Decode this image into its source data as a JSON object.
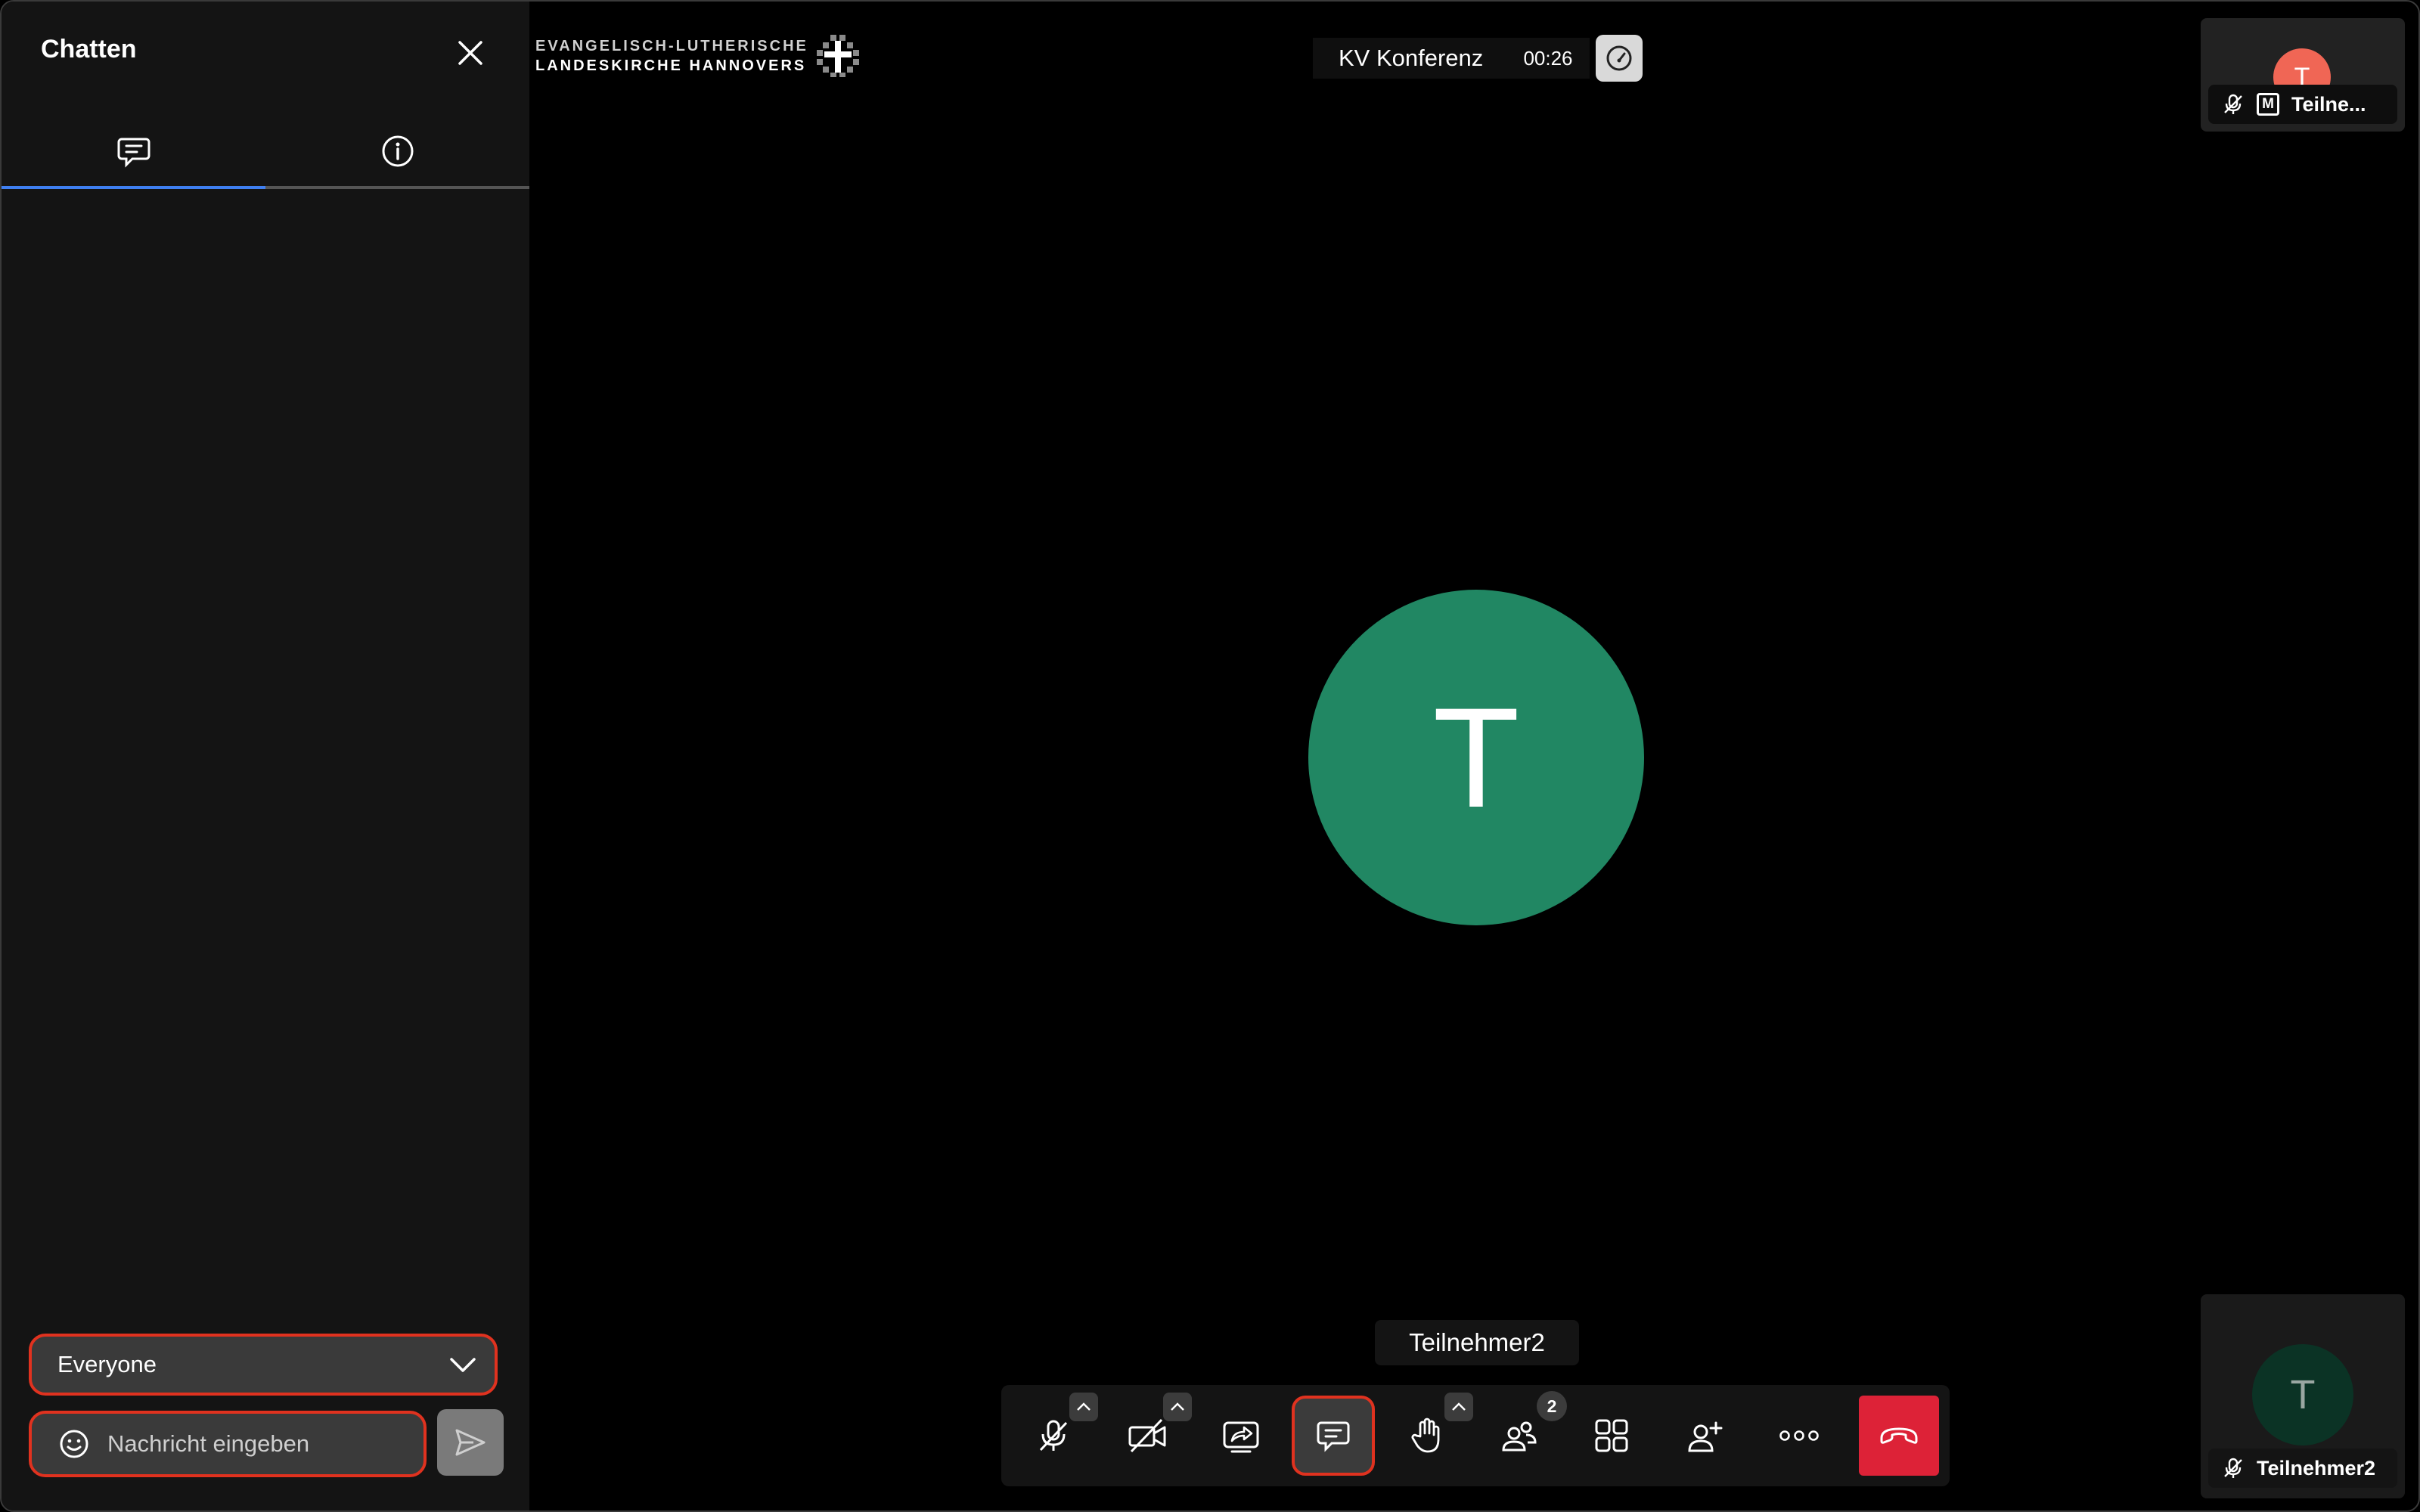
{
  "sidebar": {
    "title": "Chatten",
    "tabs": [
      {
        "name": "chat",
        "icon": "chat-icon"
      },
      {
        "name": "info",
        "icon": "info-icon"
      }
    ],
    "recipient_selected": "Everyone",
    "message_placeholder": "Nachricht eingeben",
    "message_value": ""
  },
  "header": {
    "logo_line1": "EVANGELISCH-LUTHERISCHE",
    "logo_line2": "LANDESKIRCHE HANNOVERS",
    "meeting_title": "KV Konferenz",
    "timer": "00:26"
  },
  "stage": {
    "avatar_initial": "T",
    "tooltip": "Teilnehmer2"
  },
  "thumbnails": [
    {
      "initial": "T",
      "name": "Teilne...",
      "badge": "M"
    },
    {
      "initial": "T",
      "name": "Teilnehmer2"
    }
  ],
  "toolbar": {
    "participants_count": "2"
  },
  "colors": {
    "accent_blue": "#3f7ff1",
    "highlight_red": "#e0321f",
    "hangup_red": "#dd2237",
    "avatar_green": "#218763",
    "avatar_coral": "#f06655"
  }
}
